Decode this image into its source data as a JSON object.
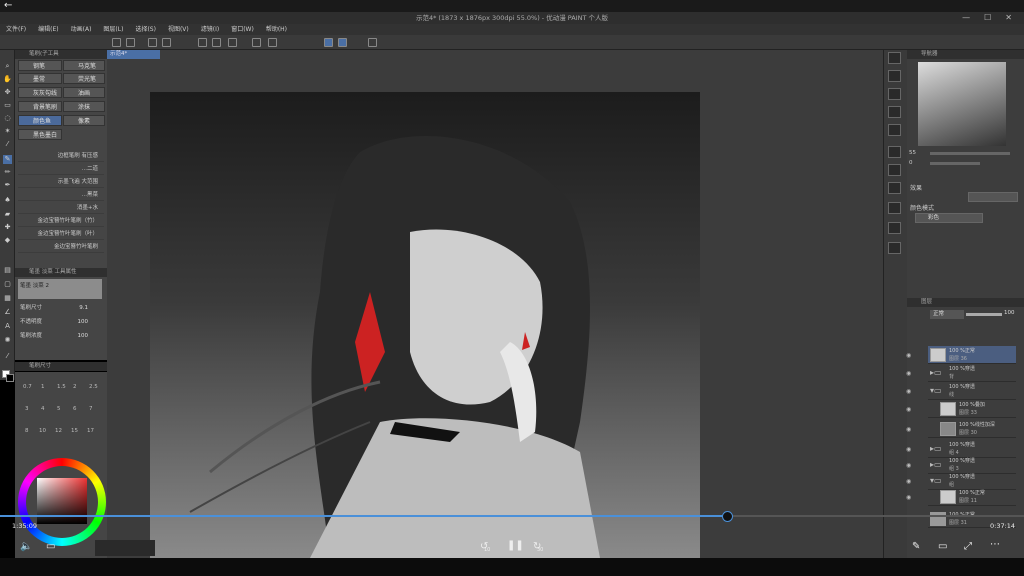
{
  "window": {
    "title": "示范4* (1873 x 1876px 300dpi 55.0%) - 优动漫 PAINT 个人版"
  },
  "menu": [
    "文件(F)",
    "编辑(E)",
    "动画(A)",
    "图层(L)",
    "选择(S)",
    "视图(V)",
    "滤镜(I)",
    "窗口(W)",
    "帮助(H)"
  ],
  "canvas_tab": "示范4*",
  "subtool": {
    "header": "笔刷(子工具",
    "buttons": [
      "钢笔",
      "马克笔",
      "墨常",
      "荧光笔",
      "灰灰勾线",
      "油画",
      "背景笔刷",
      "涂抹",
      "颜色鱼",
      "像素",
      "黑色墨白"
    ],
    "brushes": [
      "边框笔刷 有压感",
      "...二道",
      "示墨飞遍 大范围",
      "...黑菜",
      "消墨+水",
      "金边宝簪竹叶笔刷（竹）",
      "金边宝簪竹叶笔刷（叶）",
      "金边宝簪竹叶笔刷"
    ]
  },
  "tool_property": {
    "header": "笔墨 淡菜 工具属性",
    "name": "笔墨 淡菜 2",
    "rows": [
      {
        "label": "笔刷尺寸",
        "value": "9.1"
      },
      {
        "label": "不透明度",
        "value": "100"
      },
      {
        "label": "笔刷浓度",
        "value": "100"
      }
    ]
  },
  "brush_size": {
    "header": "笔刷尺寸",
    "sizes": [
      "0.7",
      "1",
      "1.5",
      "2",
      "2.5",
      "3",
      "4",
      "5",
      "6",
      "7",
      "8",
      "10",
      "12",
      "15",
      "17"
    ]
  },
  "navigator": {
    "header": "导航器",
    "zoom": "55",
    "angle": "0"
  },
  "effects": {
    "label": "效果",
    "color_mode_label": "颜色模式",
    "color_mode_value": "彩色"
  },
  "layers": {
    "header": "图层",
    "blend": "正常",
    "opacity": "100",
    "items": [
      {
        "l1": "100 %正常",
        "l2": "图层 36",
        "folder": false,
        "selected": true
      },
      {
        "l1": "100 %穿透",
        "l2": "背",
        "folder": true,
        "selected": false
      },
      {
        "l1": "100 %穿透",
        "l2": "线",
        "folder": true,
        "selected": false
      },
      {
        "l1": "100 %叠加",
        "l2": "图层 33",
        "folder": false,
        "selected": false
      },
      {
        "l1": "100 %线性加深",
        "l2": "图层 30",
        "folder": false,
        "selected": false
      },
      {
        "l1": "100 %穿透",
        "l2": "组 4",
        "folder": true,
        "selected": false
      },
      {
        "l1": "100 %穿透",
        "l2": "组 3",
        "folder": true,
        "selected": false
      },
      {
        "l1": "100 %穿透",
        "l2": "组",
        "folder": true,
        "selected": false
      },
      {
        "l1": "100 %正常",
        "l2": "图层 11",
        "folder": false,
        "selected": false
      },
      {
        "l1": "100 %正常",
        "l2": "图层 31",
        "folder": false,
        "selected": false
      }
    ]
  },
  "video": {
    "elapsed": "1:35:09",
    "remaining": "0:37:14",
    "rewind_label": "10",
    "forward_label": "30",
    "progress_pct": 71
  }
}
